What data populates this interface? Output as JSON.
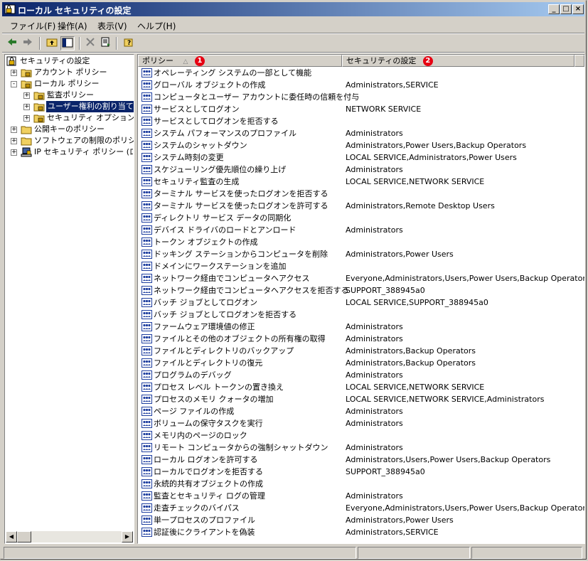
{
  "window": {
    "title": "ローカル セキュリティの設定",
    "controls": {
      "minimize": "_",
      "maximize": "□",
      "close": "×"
    }
  },
  "menu": [
    "ファイル(F)",
    "操作(A)",
    "表示(V)",
    "ヘルプ(H)"
  ],
  "toolbar": {
    "icons": [
      "back-arrow-icon",
      "forward-arrow-icon",
      "up-folder-icon",
      "show-hide-tree-icon",
      "delete-icon",
      "export-list-icon",
      "help-icon"
    ]
  },
  "tree": {
    "root": "セキュリティの設定",
    "items": [
      {
        "label": "アカウント ポリシー",
        "expander": "+"
      },
      {
        "label": "ローカル ポリシー",
        "expander": "-"
      },
      {
        "label": "監査ポリシー",
        "expander": "+"
      },
      {
        "label": "ユーザー権利の割り当て",
        "expander": "+"
      },
      {
        "label": "セキュリティ オプション",
        "expander": "+"
      },
      {
        "label": "公開キーのポリシー",
        "expander": "+"
      },
      {
        "label": "ソフトウェアの制限のポリシー",
        "expander": "+"
      },
      {
        "label": "IP セキュリティ ポリシー (ローカル コンピュータ)",
        "expander": "+"
      }
    ]
  },
  "list": {
    "columns": {
      "policy": "ポリシー",
      "sort_arrow": "△",
      "setting": "セキュリティの設定"
    },
    "badges": {
      "one": "1",
      "two": "2"
    },
    "rows": [
      {
        "policy": "オペレーティング システムの一部として機能",
        "setting": ""
      },
      {
        "policy": "グローバル オブジェクトの作成",
        "setting": "Administrators,SERVICE"
      },
      {
        "policy": "コンピュータとユーザー アカウントに委任時の信頼を付与",
        "setting": ""
      },
      {
        "policy": "サービスとしてログオン",
        "setting": "NETWORK SERVICE"
      },
      {
        "policy": "サービスとしてログオンを拒否する",
        "setting": ""
      },
      {
        "policy": "システム パフォーマンスのプロファイル",
        "setting": "Administrators"
      },
      {
        "policy": "システムのシャットダウン",
        "setting": "Administrators,Power Users,Backup Operators"
      },
      {
        "policy": "システム時刻の変更",
        "setting": "LOCAL SERVICE,Administrators,Power Users"
      },
      {
        "policy": "スケジューリング優先順位の繰り上げ",
        "setting": "Administrators"
      },
      {
        "policy": "セキュリティ監査の生成",
        "setting": "LOCAL SERVICE,NETWORK SERVICE"
      },
      {
        "policy": "ターミナル サービスを使ったログオンを拒否する",
        "setting": ""
      },
      {
        "policy": "ターミナル サービスを使ったログオンを許可する",
        "setting": "Administrators,Remote Desktop Users"
      },
      {
        "policy": "ディレクトリ サービス データの同期化",
        "setting": ""
      },
      {
        "policy": "デバイス ドライバのロードとアンロード",
        "setting": "Administrators"
      },
      {
        "policy": "トークン オブジェクトの作成",
        "setting": ""
      },
      {
        "policy": "ドッキング ステーションからコンピュータを削除",
        "setting": "Administrators,Power Users"
      },
      {
        "policy": "ドメインにワークステーションを追加",
        "setting": ""
      },
      {
        "policy": "ネットワーク経由でコンピュータへアクセス",
        "setting": "Everyone,Administrators,Users,Power Users,Backup Operators"
      },
      {
        "policy": "ネットワーク経由でコンピュータへアクセスを拒否する",
        "setting": "SUPPORT_388945a0"
      },
      {
        "policy": "バッチ ジョブとしてログオン",
        "setting": "LOCAL SERVICE,SUPPORT_388945a0"
      },
      {
        "policy": "バッチ ジョブとしてログオンを拒否する",
        "setting": ""
      },
      {
        "policy": "ファームウェア環境値の修正",
        "setting": "Administrators"
      },
      {
        "policy": "ファイルとその他のオブジェクトの所有権の取得",
        "setting": "Administrators"
      },
      {
        "policy": "ファイルとディレクトリのバックアップ",
        "setting": "Administrators,Backup Operators"
      },
      {
        "policy": "ファイルとディレクトリの復元",
        "setting": "Administrators,Backup Operators"
      },
      {
        "policy": "プログラムのデバッグ",
        "setting": "Administrators"
      },
      {
        "policy": "プロセス レベル トークンの置き換え",
        "setting": "LOCAL SERVICE,NETWORK SERVICE"
      },
      {
        "policy": "プロセスのメモリ クォータの増加",
        "setting": "LOCAL SERVICE,NETWORK SERVICE,Administrators"
      },
      {
        "policy": "ページ ファイルの作成",
        "setting": "Administrators"
      },
      {
        "policy": "ボリュームの保守タスクを実行",
        "setting": "Administrators"
      },
      {
        "policy": "メモリ内のページのロック",
        "setting": ""
      },
      {
        "policy": "リモート コンピュータからの強制シャットダウン",
        "setting": "Administrators"
      },
      {
        "policy": "ローカル ログオンを許可する",
        "setting": "Administrators,Users,Power Users,Backup Operators"
      },
      {
        "policy": "ローカルでログオンを拒否する",
        "setting": "SUPPORT_388945a0"
      },
      {
        "policy": "永続的共有オブジェクトの作成",
        "setting": ""
      },
      {
        "policy": "監査とセキュリティ ログの管理",
        "setting": "Administrators"
      },
      {
        "policy": "走査チェックのバイパス",
        "setting": "Everyone,Administrators,Users,Power Users,Backup Operators"
      },
      {
        "policy": "単一プロセスのプロファイル",
        "setting": "Administrators,Power Users"
      },
      {
        "policy": "認証後にクライアントを偽装",
        "setting": "Administrators,SERVICE"
      }
    ]
  },
  "colors": {
    "title_start": "#0a246a",
    "title_end": "#a6caf0",
    "selection": "#0a246a",
    "badge": "#e60012"
  }
}
